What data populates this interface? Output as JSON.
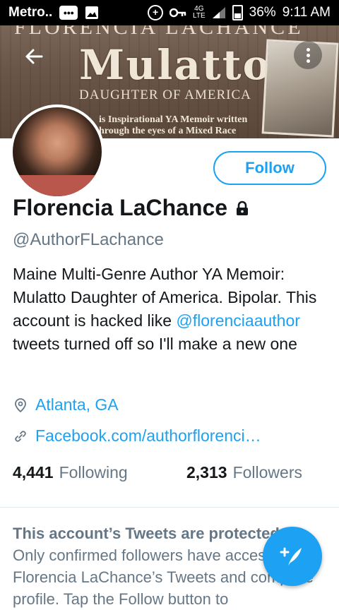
{
  "status_bar": {
    "carrier": "Metro..",
    "battery": "36%",
    "time": "9:11 AM",
    "network_label": "4G",
    "lte_label": "LTE"
  },
  "banner": {
    "top_text": "FLORENCIA LACHANCE",
    "title": "Mulatto",
    "subtitle": "DAUGHTER OF AMERICA",
    "line1": "is Inspirational YA Memoir written",
    "line2": "hrough the eyes of a Mixed Race"
  },
  "profile": {
    "name": "Florencia LaChance",
    "handle": "@AuthorFLachance",
    "follow_label": "Follow",
    "bio_part1": "Maine Multi-Genre Author YA Memoir: Mulatto Daughter of America. Bipolar. This account is hacked like ",
    "bio_mention": "@florenciaauthor",
    "bio_part2": " tweets turned off so I'll make a new one",
    "location": "Atlanta, GA",
    "website": "Facebook.com/authorflorenci…",
    "following_count": "4,441",
    "following_label": "Following",
    "followers_count": "2,313",
    "followers_label": "Followers"
  },
  "protected_notice": {
    "title": "This account’s Tweets are protected",
    "body": "Only confirmed followers have access to Florencia LaChance’s Tweets and complete profile. Tap the Follow button to"
  },
  "colors": {
    "accent": "#1da1f2",
    "secondary_text": "#657786",
    "primary_text": "#14171a"
  },
  "icons": {
    "back": "back-arrow-icon",
    "more": "more-vertical-icon",
    "lock": "lock-icon",
    "location": "location-pin-icon",
    "link": "link-icon",
    "compose": "compose-tweet-icon"
  }
}
